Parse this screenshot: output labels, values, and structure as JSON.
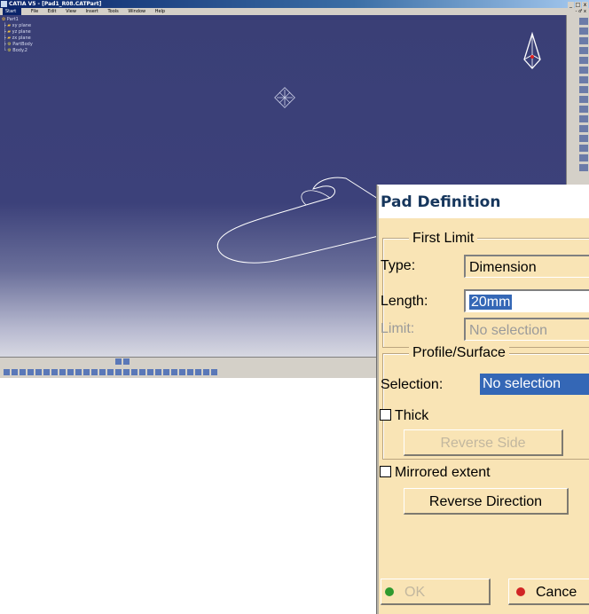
{
  "window": {
    "title": "CATIA V5 - [Pad1_R08.CATPart]",
    "controls": [
      "_",
      "□",
      "x"
    ]
  },
  "menu": {
    "items": [
      "Start",
      "File",
      "Edit",
      "View",
      "Insert",
      "Tools",
      "Window",
      "Help"
    ],
    "window_controls": "- ♂ x"
  },
  "tree": {
    "root": "Part1",
    "items": [
      "xy plane",
      "yz plane",
      "zx plane",
      "PartBody",
      "Body.2"
    ]
  },
  "dialog": {
    "title": "Pad Definition",
    "first_limit": {
      "legend": "First Limit",
      "type_label": "Type:",
      "type_value": "Dimension",
      "length_label": "Length:",
      "length_value": "20mm",
      "limit_label": "Limit:",
      "limit_value": "No selection"
    },
    "profile": {
      "legend": "Profile/Surface",
      "selection_label": "Selection:",
      "selection_value": "No selection",
      "thick_label": "Thick",
      "thick_checked": false,
      "reverse_side_label": "Reverse Side"
    },
    "mirrored_label": "Mirrored extent",
    "mirrored_checked": false,
    "reverse_direction_label": "Reverse Direction",
    "ok_label": "OK",
    "cancel_label": "Cance"
  },
  "colors": {
    "dialog_bg": "#f9e4b5",
    "selection_blue": "#3467b6",
    "ok_led": "#2f9a2f",
    "cancel_led": "#d12525"
  }
}
